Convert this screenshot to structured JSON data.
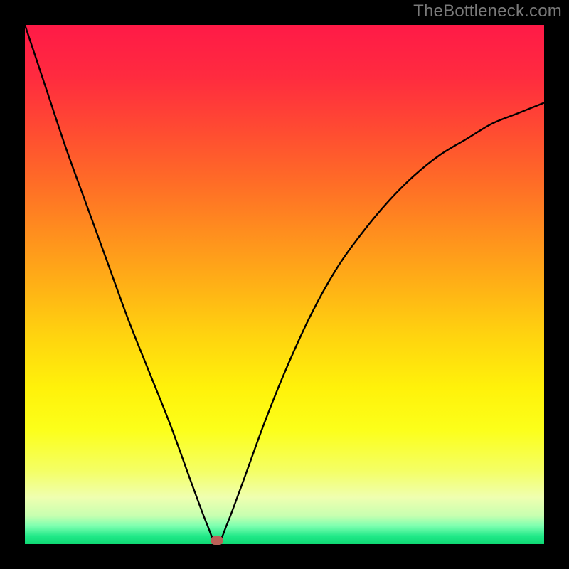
{
  "watermark": "TheBottleneck.com",
  "colors": {
    "frame": "#000000",
    "watermark": "#7a7a7a",
    "curve": "#000000",
    "marker": "#bb6057",
    "gradient_stops": [
      {
        "offset": 0.0,
        "color": "#ff1a47"
      },
      {
        "offset": 0.1,
        "color": "#ff2b3f"
      },
      {
        "offset": 0.2,
        "color": "#ff4a32"
      },
      {
        "offset": 0.3,
        "color": "#ff6b27"
      },
      {
        "offset": 0.4,
        "color": "#ff8e1e"
      },
      {
        "offset": 0.5,
        "color": "#ffb016"
      },
      {
        "offset": 0.6,
        "color": "#ffd40f"
      },
      {
        "offset": 0.7,
        "color": "#fff20a"
      },
      {
        "offset": 0.78,
        "color": "#fcff1a"
      },
      {
        "offset": 0.86,
        "color": "#f4ff66"
      },
      {
        "offset": 0.91,
        "color": "#efffb0"
      },
      {
        "offset": 0.945,
        "color": "#c8ffb0"
      },
      {
        "offset": 0.965,
        "color": "#7dffb0"
      },
      {
        "offset": 0.985,
        "color": "#20e988"
      },
      {
        "offset": 1.0,
        "color": "#0fd873"
      }
    ]
  },
  "chart_data": {
    "type": "line",
    "title": "",
    "xlabel": "",
    "ylabel": "",
    "xlim": [
      0,
      100
    ],
    "ylim": [
      0,
      100
    ],
    "grid": false,
    "legend": false,
    "annotations": [],
    "minimum_marker": {
      "x": 37,
      "y": 0
    },
    "series": [
      {
        "name": "curve",
        "x": [
          0,
          4,
          8,
          12,
          16,
          20,
          24,
          28,
          32,
          35,
          37,
          39,
          42,
          46,
          50,
          55,
          60,
          65,
          70,
          75,
          80,
          85,
          90,
          95,
          100
        ],
        "y": [
          100,
          88,
          76,
          65,
          54,
          43,
          33,
          23,
          12,
          4,
          0,
          4,
          12,
          23,
          33,
          44,
          53,
          60,
          66,
          71,
          75,
          78,
          81,
          83,
          85
        ]
      }
    ]
  }
}
